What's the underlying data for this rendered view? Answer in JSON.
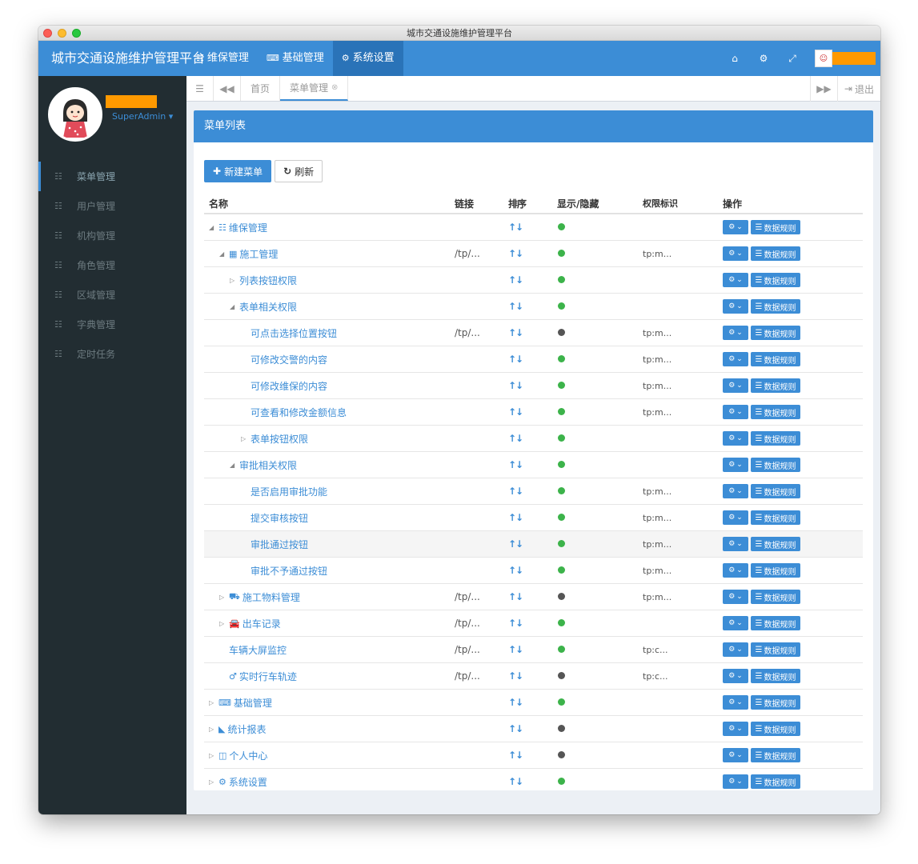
{
  "window": {
    "title": "城市交通设施维护管理平台"
  },
  "header": {
    "brand": "城市交通设施维护管理平台",
    "menu": [
      {
        "icon": "list-icon",
        "glyph": "☷",
        "label": "维保管理",
        "active": false
      },
      {
        "icon": "keyboard-icon",
        "glyph": "⌨",
        "label": "基础管理",
        "active": false
      },
      {
        "icon": "gear-icon",
        "glyph": "⚙",
        "label": "系统设置",
        "active": true
      }
    ],
    "right_icons": [
      "home-icon",
      "cogs-icon",
      "fullscreen-icon"
    ],
    "right_glyphs": [
      "⌂",
      "⚙",
      "⤢"
    ]
  },
  "sidebar": {
    "role": "SuperAdmin ▾",
    "items": [
      {
        "label": "菜单管理",
        "active": true
      },
      {
        "label": "用户管理",
        "active": false
      },
      {
        "label": "机构管理",
        "active": false
      },
      {
        "label": "角色管理",
        "active": false
      },
      {
        "label": "区域管理",
        "active": false
      },
      {
        "label": "字典管理",
        "active": false
      },
      {
        "label": "定时任务",
        "active": false
      }
    ]
  },
  "tabs": {
    "home": "首页",
    "current": "菜单管理",
    "logout": "退出"
  },
  "panel": {
    "title": "菜单列表",
    "new_button": "新建菜单",
    "refresh_button": "刷新"
  },
  "table": {
    "columns": [
      "名称",
      "链接",
      "排序",
      "显示/隐藏",
      "权限标识",
      "操作"
    ],
    "sort_glyph": "↑↓",
    "rule_label": "数据规则",
    "colors": {
      "shown": "#3cb34a",
      "hidden": "#555555"
    },
    "rows": [
      {
        "level": 0,
        "expander": "open",
        "icon": "☷",
        "name": "维保管理",
        "link": "",
        "visible": true,
        "perm": "",
        "hl": false
      },
      {
        "level": 1,
        "expander": "open",
        "icon": "▦",
        "name": "施工管理",
        "link": "/tp/...",
        "visible": true,
        "perm": "tp:m...",
        "hl": false
      },
      {
        "level": 2,
        "expander": "closed",
        "icon": "",
        "name": "列表按钮权限",
        "link": "",
        "visible": true,
        "perm": "",
        "hl": false
      },
      {
        "level": 2,
        "expander": "open",
        "icon": "",
        "name": "表单相关权限",
        "link": "",
        "visible": true,
        "perm": "",
        "hl": false
      },
      {
        "level": 3,
        "expander": "",
        "icon": "",
        "name": "可点击选择位置按钮",
        "link": "/tp/...",
        "visible": false,
        "perm": "tp:m...",
        "hl": false
      },
      {
        "level": 3,
        "expander": "",
        "icon": "",
        "name": "可修改交警的内容",
        "link": "",
        "visible": true,
        "perm": "tp:m...",
        "hl": false
      },
      {
        "level": 3,
        "expander": "",
        "icon": "",
        "name": "可修改维保的内容",
        "link": "",
        "visible": true,
        "perm": "tp:m...",
        "hl": false
      },
      {
        "level": 3,
        "expander": "",
        "icon": "",
        "name": "可查看和修改金额信息",
        "link": "",
        "visible": true,
        "perm": "tp:m...",
        "hl": false
      },
      {
        "level": 3,
        "expander": "closed",
        "icon": "",
        "name": "表单按钮权限",
        "link": "",
        "visible": true,
        "perm": "",
        "hl": false
      },
      {
        "level": 2,
        "expander": "open",
        "icon": "",
        "name": "审批相关权限",
        "link": "",
        "visible": true,
        "perm": "",
        "hl": false
      },
      {
        "level": 3,
        "expander": "",
        "icon": "",
        "name": "是否启用审批功能",
        "link": "",
        "visible": true,
        "perm": "tp:m...",
        "hl": false
      },
      {
        "level": 3,
        "expander": "",
        "icon": "",
        "name": "提交审核按钮",
        "link": "",
        "visible": true,
        "perm": "tp:m...",
        "hl": false
      },
      {
        "level": 3,
        "expander": "",
        "icon": "",
        "name": "审批通过按钮",
        "link": "",
        "visible": true,
        "perm": "tp:m...",
        "hl": true
      },
      {
        "level": 3,
        "expander": "",
        "icon": "",
        "name": "审批不予通过按钮",
        "link": "",
        "visible": true,
        "perm": "tp:m...",
        "hl": false
      },
      {
        "level": 1,
        "expander": "closed",
        "icon": "⛟",
        "name": "施工物料管理",
        "link": "/tp/...",
        "visible": false,
        "perm": "tp:m...",
        "hl": false
      },
      {
        "level": 1,
        "expander": "closed",
        "icon": "🚘",
        "name": "出车记录",
        "link": "/tp/...",
        "visible": true,
        "perm": "",
        "hl": false
      },
      {
        "level": 1,
        "expander": "",
        "icon": "",
        "name": "车辆大屏监控",
        "link": "/tp/...",
        "visible": true,
        "perm": "tp:c...",
        "hl": false
      },
      {
        "level": 1,
        "expander": "",
        "icon": "♂",
        "name": "实时行车轨迹",
        "link": "/tp/...",
        "visible": false,
        "perm": "tp:c...",
        "hl": false
      },
      {
        "level": 0,
        "expander": "closed",
        "icon": "⌨",
        "name": "基础管理",
        "link": "",
        "visible": true,
        "perm": "",
        "hl": false
      },
      {
        "level": 0,
        "expander": "closed",
        "icon": "◣",
        "name": "统计报表",
        "link": "",
        "visible": false,
        "perm": "",
        "hl": false
      },
      {
        "level": 0,
        "expander": "closed",
        "icon": "◫",
        "name": "个人中心",
        "link": "",
        "visible": false,
        "perm": "",
        "hl": false
      },
      {
        "level": 0,
        "expander": "closed",
        "icon": "⚙",
        "name": "系统设置",
        "link": "",
        "visible": true,
        "perm": "",
        "hl": false
      }
    ]
  }
}
